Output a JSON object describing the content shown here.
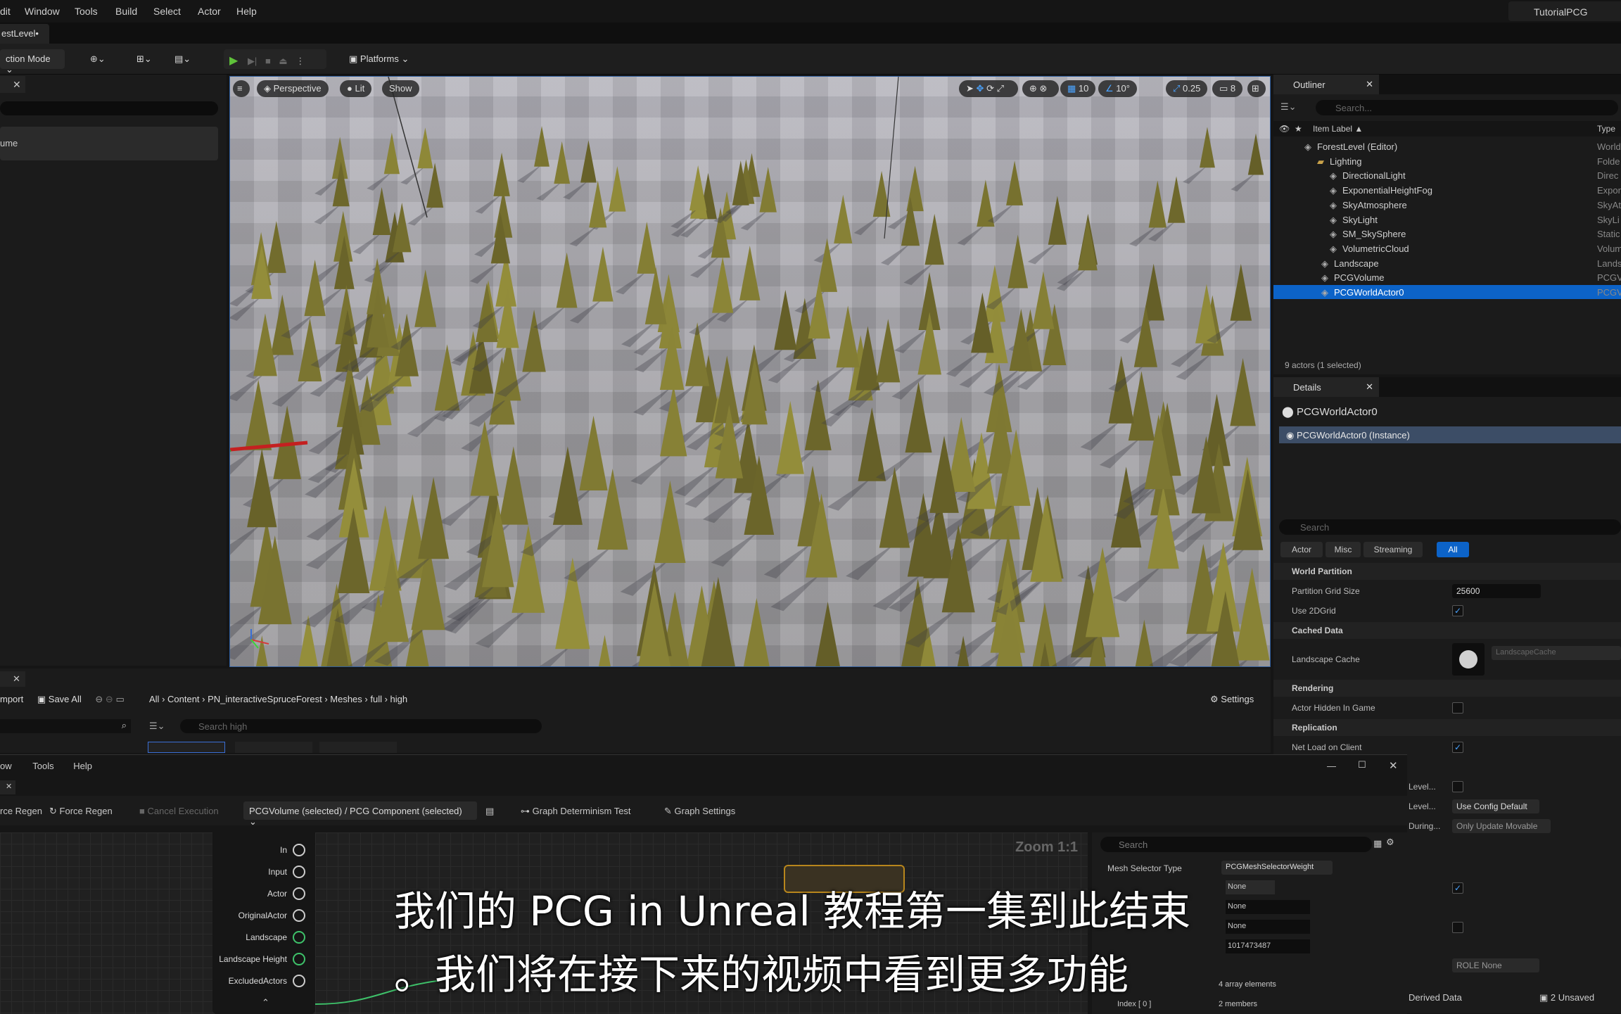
{
  "menu": [
    "dit",
    "Window",
    "Tools",
    "Build",
    "Select",
    "Actor",
    "Help"
  ],
  "project_name": "TutorialPCG",
  "level_tab": "estLevel•",
  "toolbar": {
    "mode": "ction Mode",
    "platforms": "Platforms"
  },
  "left_panel": {
    "item": "ume"
  },
  "viewport": {
    "perspective": "Perspective",
    "lit": "Lit",
    "show": "Show",
    "grid": "10",
    "angle": "10°",
    "scale": "0.25",
    "camera": "8"
  },
  "outliner": {
    "title": "Outliner",
    "search_placeholder": "Search...",
    "col_label": "Item Label ▲",
    "col_type": "Type",
    "rows": [
      {
        "label": "ForestLevel (Editor)",
        "type": "World"
      },
      {
        "label": "Lighting",
        "type": "Folde"
      },
      {
        "label": "DirectionalLight",
        "type": "Direc"
      },
      {
        "label": "ExponentialHeightFog",
        "type": "Expon"
      },
      {
        "label": "SkyAtmosphere",
        "type": "SkyAt"
      },
      {
        "label": "SkyLight",
        "type": "SkyLi"
      },
      {
        "label": "SM_SkySphere",
        "type": "Static"
      },
      {
        "label": "VolumetricCloud",
        "type": "Volum"
      },
      {
        "label": "Landscape",
        "type": "Lands"
      },
      {
        "label": "PCGVolume",
        "type": "PCGV"
      },
      {
        "label": "PCGWorldActor0",
        "type": "PCGV"
      }
    ],
    "status": "9 actors (1 selected)"
  },
  "details": {
    "title": "Details",
    "actor": "PCGWorldActor0",
    "instance": "PCGWorldActor0 (Instance)",
    "search_placeholder": "Search",
    "filters": [
      "Actor",
      "Misc",
      "Streaming",
      "All"
    ],
    "sections": {
      "wp": "World Partition",
      "cached": "Cached Data",
      "render": "Rendering",
      "repl": "Replication"
    },
    "grid_size_label": "Partition Grid Size",
    "grid_size": "25600",
    "use2d_label": "Use 2DGrid",
    "landscape_cache_label": "Landscape Cache",
    "landscape_cache": "LandscapeCache",
    "hidden_label": "Actor Hidden In Game",
    "netload_label": "Net Load on Client",
    "level1": "Level...",
    "level2": "Level...",
    "during": "During...",
    "use_config": "Use Config Default",
    "update_movable": "Only Update Movable",
    "role": "ROLE None"
  },
  "content_browser": {
    "import": "mport",
    "save_all": "Save All",
    "settings": "Settings",
    "path": [
      "All",
      "Content",
      "PN_interactiveSpruceForest",
      "Meshes",
      "full",
      "high"
    ],
    "search_placeholder": "Search high"
  },
  "pcg": {
    "menu": [
      "ow",
      "Tools",
      "Help"
    ],
    "regen": "rce Regen",
    "force_regen": "Force Regen",
    "cancel": "Cancel Execution",
    "debug_object": "PCGVolume (selected) / PCG Component (selected)",
    "determinism": "Graph Determinism Test",
    "graph_settings": "Graph Settings",
    "zoom": "Zoom 1:1",
    "pins": [
      "In",
      "Input",
      "Actor",
      "OriginalActor",
      "Landscape",
      "Landscape Height",
      "ExcludedActors"
    ],
    "details_search": "Search",
    "mesh_selector_label": "Mesh Selector Type",
    "mesh_selector": "PCGMeshSelectorWeight",
    "none1": "None",
    "none2": "None",
    "none3": "None",
    "seed": "1017473487",
    "array": "4 array elements",
    "index": "Index [ 0 ]",
    "members": "2 members"
  },
  "bottom_status": {
    "derived": "Derived Data",
    "unsaved": "2 Unsaved"
  },
  "subtitle": {
    "line1": "我们的 PCG in Unreal 教程第一集到此结束",
    "line2": "。我们将在接下来的视频中看到更多功能"
  }
}
